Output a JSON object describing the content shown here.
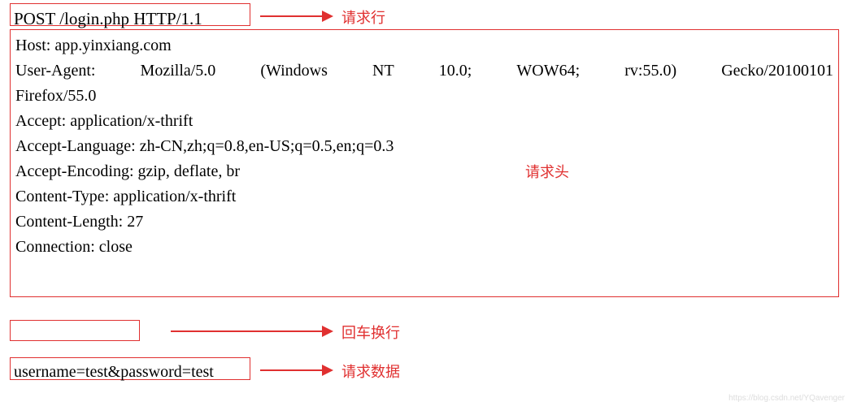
{
  "request_line": "POST /login.php HTTP/1.1",
  "headers": {
    "host": "Host: app.yinxiang.com",
    "ua_parts": [
      "User-Agent:",
      "Mozilla/5.0",
      "(Windows",
      "NT",
      "10.0;",
      "WOW64;",
      "rv:55.0)",
      "Gecko/20100101"
    ],
    "ua_tail": "Firefox/55.0",
    "accept": "Accept: application/x-thrift",
    "accept_language": "Accept-Language: zh-CN,zh;q=0.8,en-US;q=0.5,en;q=0.3",
    "accept_encoding": "Accept-Encoding: gzip, deflate, br",
    "content_type": "Content-Type: application/x-thrift",
    "content_length": "Content-Length: 27",
    "connection": "Connection: close"
  },
  "body": "username=test&password=test",
  "labels": {
    "request_line": "请求行",
    "headers": "请求头",
    "crlf": "回车换行",
    "body": "请求数据"
  },
  "watermark": "https://blog.csdn.net/YQavenger"
}
